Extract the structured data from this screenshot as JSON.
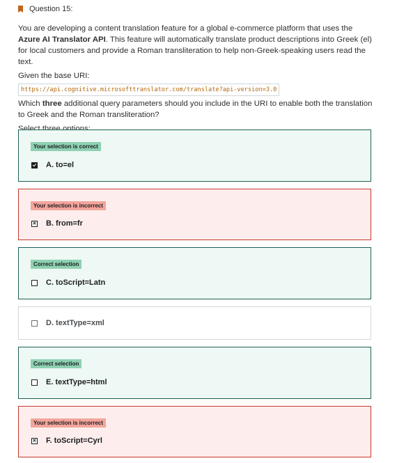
{
  "question": {
    "label": "Question 15:",
    "icon": "bookmark-icon",
    "icon_color": "#c1651a"
  },
  "prompt": {
    "p1_before": "You are developing a content translation feature for a global e-commerce platform that uses the ",
    "p1_bold": "Azure AI Translator API",
    "p1_after": ". This feature will automatically translate product descriptions into Greek (el) for local customers and provide a Roman transliteration to help non-Greek-speaking users read the text.",
    "given": "Given the base URI:",
    "uri": "https://api.cognitive.microsofttranslator.com/translate?api-version=3.0",
    "q_before": "Which ",
    "q_bold": "three",
    "q_after": " additional query parameters should you include in the URI to enable both the translation to Greek and the Roman transliteration?",
    "instruction": "Select three options:"
  },
  "colors": {
    "correct_border": "#1e6055",
    "correct_bg": "#eef8f4",
    "incorrect_border": "#c4382a",
    "incorrect_bg": "#fdeeed",
    "badge_green": "#8ed1b2",
    "badge_red": "#f3a59c"
  },
  "options": [
    {
      "label": "A. to=el",
      "badge": "Your selection is correct",
      "state": "correct",
      "checkbox": "checked"
    },
    {
      "label": "B. from=fr",
      "badge": "Your selection is incorrect",
      "state": "incorrect",
      "checkbox": "crossed"
    },
    {
      "label": "C. toScript=Latn",
      "badge": "Correct selection",
      "state": "missed",
      "checkbox": "unchecked"
    },
    {
      "label": "D. textType=xml",
      "badge": "",
      "state": "neutral",
      "checkbox": "unchecked"
    },
    {
      "label": "E. textType=html",
      "badge": "Correct selection",
      "state": "missed",
      "checkbox": "unchecked"
    },
    {
      "label": "F. toScript=Cyrl",
      "badge": "Your selection is incorrect",
      "state": "incorrect",
      "checkbox": "crossed"
    }
  ]
}
